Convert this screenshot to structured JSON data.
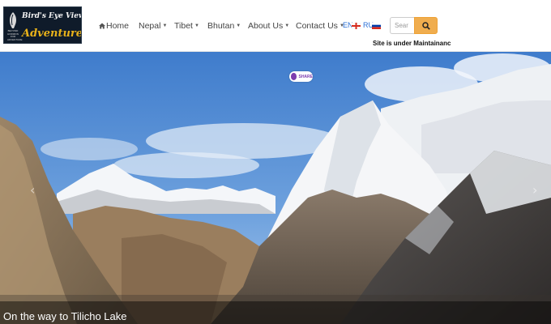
{
  "logo": {
    "line1": "Bird's Eye View",
    "line2": "Adventure",
    "tagline": "BEYOND HORIZON FOR ADVENTURE"
  },
  "nav": {
    "home": "Home",
    "nepal": "Nepal",
    "tibet": "Tibet",
    "bhutan": "Bhutan",
    "about": "About Us",
    "contact": "Contact Us"
  },
  "lang": {
    "en": "EN",
    "ru": "RU"
  },
  "search": {
    "placeholder": "Sear"
  },
  "notice": "Site is under Maintainanc",
  "share": {
    "label": "SHARE"
  },
  "slider": {
    "caption": "On the way to Tilicho Lake",
    "prev": "‹",
    "next": "›"
  },
  "colors": {
    "accent": "#f0ad4e",
    "sky": "#4a86d4",
    "link": "#2a6fd6"
  }
}
